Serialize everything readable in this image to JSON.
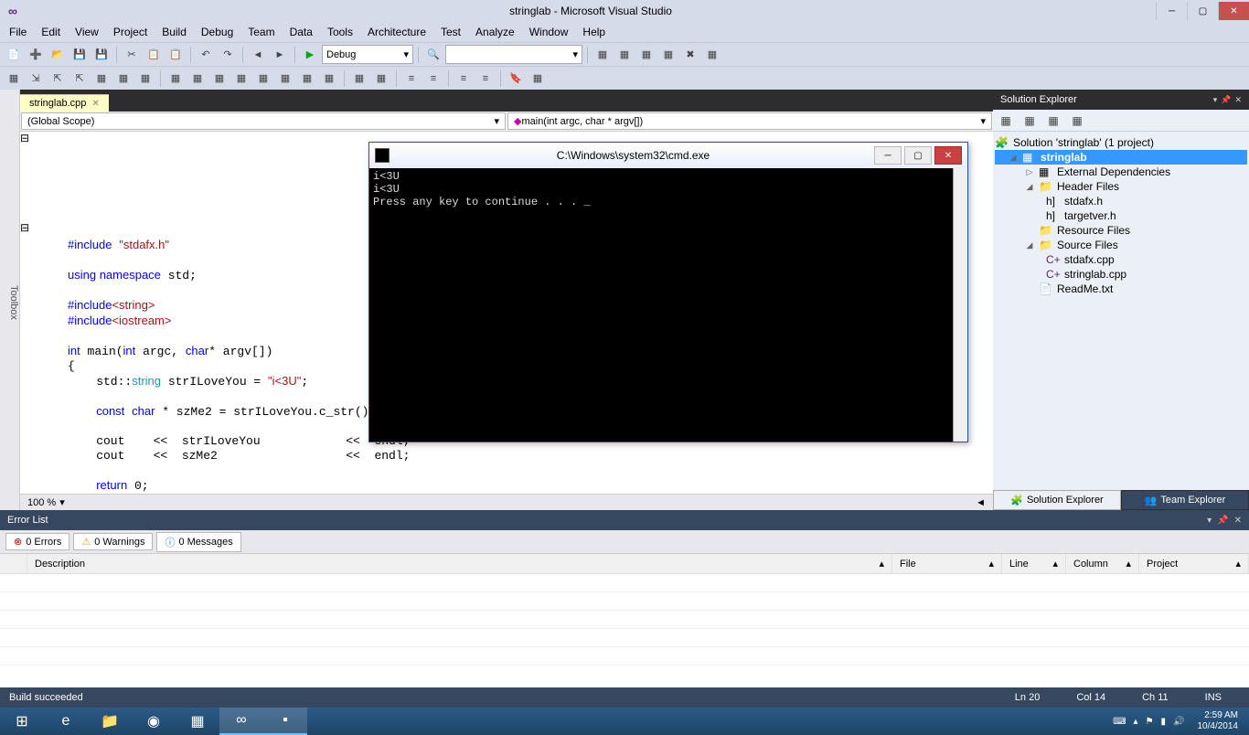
{
  "window": {
    "title": "stringlab - Microsoft Visual Studio"
  },
  "menu": [
    "File",
    "Edit",
    "View",
    "Project",
    "Build",
    "Debug",
    "Team",
    "Data",
    "Tools",
    "Architecture",
    "Test",
    "Analyze",
    "Window",
    "Help"
  ],
  "toolbar": {
    "config": "Debug"
  },
  "document": {
    "tab": "stringlab.cpp",
    "scope_left": "(Global Scope)",
    "scope_right": "main(int argc, char * argv[])",
    "zoom": "100 %",
    "code_html": "<span class='kw'>#include</span> <span class='str'>\"stdafx.h\"</span>\n\n<span class='kw'>using namespace</span> std;\n\n<span class='kw'>#include</span><span class='str'>&lt;string&gt;</span>\n<span class='kw'>#include</span><span class='str'>&lt;iostream&gt;</span>\n\n<span class='kw'>int</span> main(<span class='kw'>int</span> argc, <span class='kw'>char</span>* argv[])\n{\n    std::<span class='type'>string</span> strILoveYou = <span class='str'>\"i&lt;3U\"</span>;\n\n    <span class='kw'>const</span> <span class='kw'>char</span> * szMe2 = strILoveYou.c_str();\n\n    cout    &lt;&lt;  strILoveYou            &lt;&lt;  endl;\n    cout    &lt;&lt;  szMe2                  &lt;&lt;  endl;\n\n    <span class='kw'>return</span> 0;\n}"
  },
  "console": {
    "title": "C:\\Windows\\system32\\cmd.exe",
    "body": "i<3U\ni<3U\nPress any key to continue . . . _"
  },
  "solution_explorer": {
    "title": "Solution Explorer",
    "root": "Solution 'stringlab' (1 project)",
    "project": "stringlab",
    "folders": {
      "external": "External Dependencies",
      "header": "Header Files",
      "header_files": [
        "stdafx.h",
        "targetver.h"
      ],
      "resource": "Resource Files",
      "source": "Source Files",
      "source_files": [
        "stdafx.cpp",
        "stringlab.cpp"
      ],
      "readme": "ReadMe.txt"
    },
    "tab1": "Solution Explorer",
    "tab2": "Team Explorer"
  },
  "errorlist": {
    "title": "Error List",
    "errors": "0 Errors",
    "warnings": "0 Warnings",
    "messages": "0 Messages",
    "cols": {
      "desc": "Description",
      "file": "File",
      "line": "Line",
      "col": "Column",
      "proj": "Project"
    }
  },
  "status": {
    "build": "Build succeeded",
    "ln": "Ln 20",
    "col": "Col 14",
    "ch": "Ch 11",
    "ins": "INS"
  },
  "taskbar": {
    "time": "2:59 AM",
    "date": "10/4/2014"
  }
}
